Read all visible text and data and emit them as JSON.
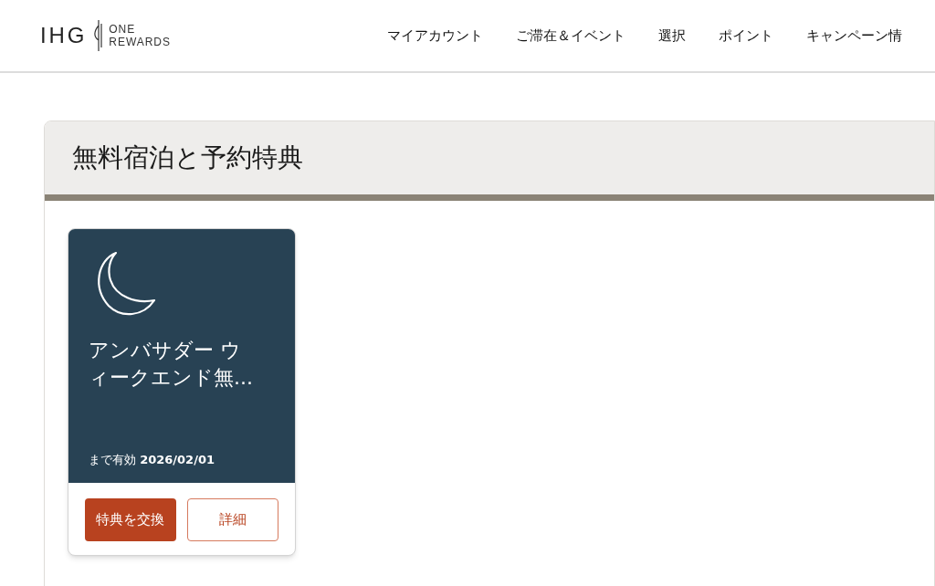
{
  "header": {
    "logo": {
      "brand": "IHG",
      "line1": "ONE",
      "line2": "REWARDS"
    },
    "nav": [
      "マイアカウント",
      "ご滞在＆イベント",
      "選択",
      "ポイント",
      "キャンペーン情"
    ]
  },
  "section": {
    "title": "無料宿泊と予約特典",
    "cards": [
      {
        "title": "アンバサダー ウィークエンド無...",
        "validity": "まで有効 **2026/02/01**",
        "primary_button": "特典を交換",
        "secondary_button": "詳細"
      }
    ]
  }
}
